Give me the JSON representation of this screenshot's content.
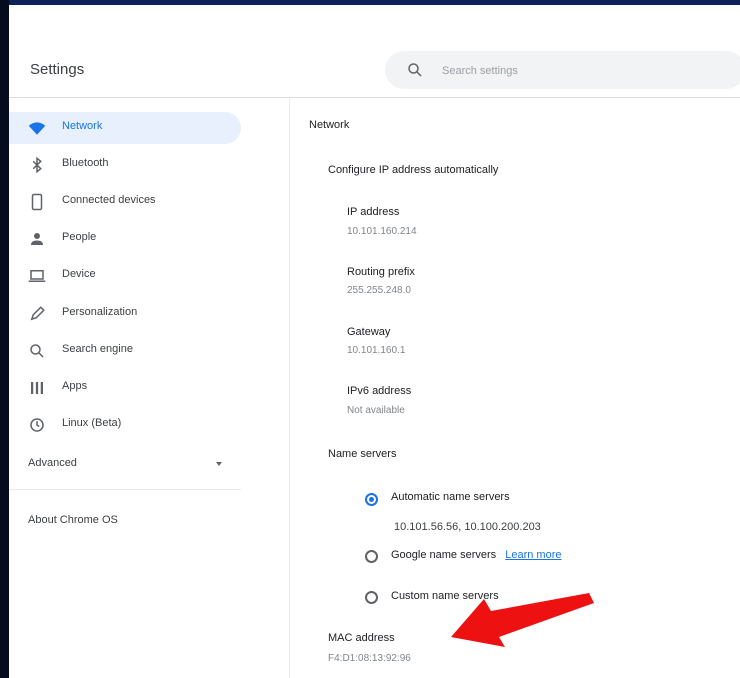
{
  "header": {
    "title": "Settings",
    "search_placeholder": "Search settings"
  },
  "sidebar": {
    "items": [
      {
        "label": "Network",
        "icon": "wifi-icon",
        "active": true
      },
      {
        "label": "Bluetooth",
        "icon": "bluetooth-icon"
      },
      {
        "label": "Connected devices",
        "icon": "phone-icon"
      },
      {
        "label": "People",
        "icon": "person-icon"
      },
      {
        "label": "Device",
        "icon": "laptop-icon"
      },
      {
        "label": "Personalization",
        "icon": "pen-icon"
      },
      {
        "label": "Search engine",
        "icon": "search-icon"
      },
      {
        "label": "Apps",
        "icon": "apps-icon"
      },
      {
        "label": "Linux (Beta)",
        "icon": "clock-icon"
      }
    ],
    "advanced_label": "Advanced",
    "about_label": "About Chrome OS"
  },
  "main": {
    "breadcrumb": "Network",
    "config_label": "Configure IP address automatically",
    "fields": [
      {
        "label": "IP address",
        "value": "10.101.160.214"
      },
      {
        "label": "Routing prefix",
        "value": "255.255.248.0"
      },
      {
        "label": "Gateway",
        "value": "10.101.160.1"
      },
      {
        "label": "IPv6 address",
        "value": "Not available"
      }
    ],
    "name_servers_label": "Name servers",
    "options": {
      "automatic": {
        "label": "Automatic name servers",
        "detail": "10.101.56.56, 10.100.200.203",
        "selected": true
      },
      "google": {
        "label": "Google name servers",
        "link": "Learn more",
        "selected": false
      },
      "custom": {
        "label": "Custom name servers",
        "selected": false
      }
    },
    "mac_label": "MAC address",
    "mac_value": "F4:D1:08:13:92:96"
  },
  "colors": {
    "accent": "#1a73e8",
    "annotation_arrow": "#ee1111",
    "active_bg": "#e8f0fe"
  }
}
